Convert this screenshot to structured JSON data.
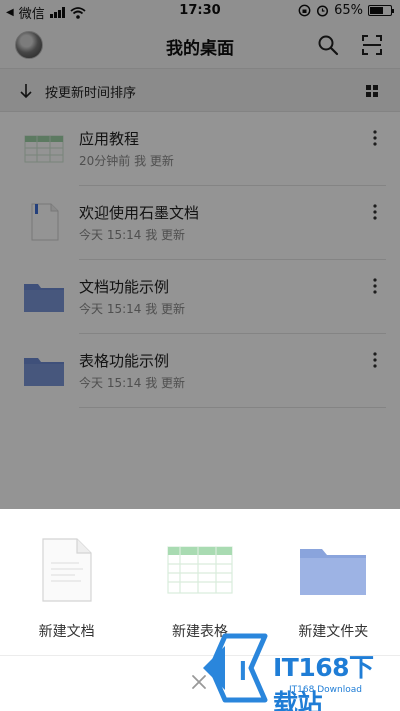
{
  "status_bar": {
    "carrier": "微信",
    "time": "17:30",
    "battery": "65%",
    "battery_level": 0.65
  },
  "header": {
    "title": "我的桌面"
  },
  "sort_bar": {
    "label": "按更新时间排序"
  },
  "files": [
    {
      "name": "应用教程",
      "meta": "20分钟前 我 更新",
      "type": "sheet"
    },
    {
      "name": "欢迎使用石墨文档",
      "meta": "今天 15:14 我 更新",
      "type": "doc"
    },
    {
      "name": "文档功能示例",
      "meta": "今天 15:14 我 更新",
      "type": "folder"
    },
    {
      "name": "表格功能示例",
      "meta": "今天 15:14 我 更新",
      "type": "folder"
    }
  ],
  "sheet": {
    "actions": [
      {
        "label": "新建文档",
        "icon": "document-icon"
      },
      {
        "label": "新建表格",
        "icon": "spreadsheet-icon"
      },
      {
        "label": "新建文件夹",
        "icon": "folder-icon"
      }
    ]
  },
  "watermark": {
    "title": "IT168下载站",
    "subtitle": "IT168 Download"
  },
  "colors": {
    "folder": "#7b97d8",
    "accent": "#1f7dd6",
    "doc_flag": "#3f6fd6",
    "sheet_green": "#9fd3a8"
  }
}
